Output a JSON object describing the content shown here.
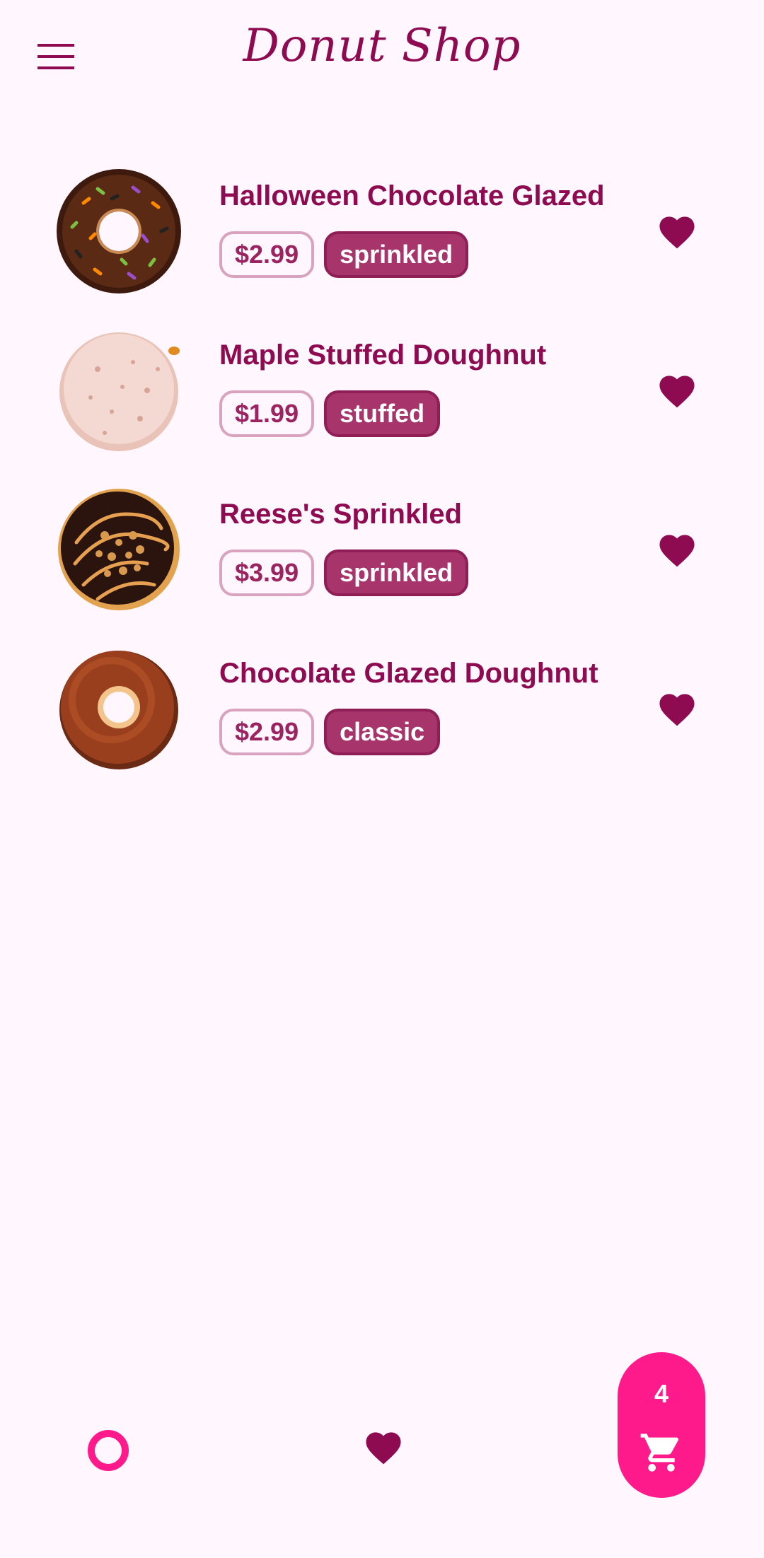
{
  "app_bar": {
    "title": "Donut Shop",
    "menu_icon": "menu-icon"
  },
  "colors": {
    "background": "#FFF7FD",
    "primary": "#8E0B51",
    "tag": "#A8346C",
    "price_border": "#D9A3BF",
    "fab": "#FF1A8C"
  },
  "donuts": [
    {
      "name": "Halloween Chocolate Glazed",
      "price": "$2.99",
      "tag": "sprinkled",
      "favorite": true
    },
    {
      "name": "Maple Stuffed Doughnut",
      "price": "$1.99",
      "tag": "stuffed",
      "favorite": true
    },
    {
      "name": "Reese's Sprinkled",
      "price": "$3.99",
      "tag": "sprinkled",
      "favorite": true
    },
    {
      "name": "Chocolate Glazed Doughnut",
      "price": "$2.99",
      "tag": "classic",
      "favorite": true
    }
  ],
  "bottom_nav": {
    "items": [
      {
        "icon": "donut-ring-icon"
      },
      {
        "icon": "heart-icon"
      }
    ]
  },
  "cart": {
    "count": "4",
    "icon": "cart-icon"
  }
}
